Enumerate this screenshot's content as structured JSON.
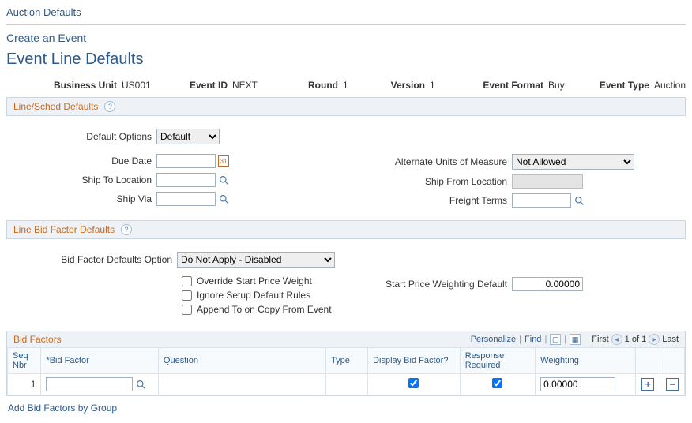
{
  "breadcrumb": "Auction Defaults",
  "create_link": "Create an Event",
  "page_title": "Event Line Defaults",
  "info": {
    "business_unit_label": "Business Unit",
    "business_unit": "US001",
    "event_id_label": "Event ID",
    "event_id": "NEXT",
    "round_label": "Round",
    "round": "1",
    "version_label": "Version",
    "version": "1",
    "event_format_label": "Event Format",
    "event_format": "Buy",
    "event_type_label": "Event Type",
    "event_type": "Auction"
  },
  "section1": {
    "title": "Line/Sched Defaults",
    "default_options_label": "Default Options",
    "default_options_value": "Default",
    "due_date_label": "Due Date",
    "due_date_value": "",
    "ship_to_label": "Ship To Location",
    "ship_to_value": "",
    "ship_via_label": "Ship Via",
    "ship_via_value": "",
    "alt_uom_label": "Alternate Units of Measure",
    "alt_uom_value": "Not Allowed",
    "ship_from_label": "Ship From Location",
    "freight_terms_label": "Freight Terms",
    "freight_terms_value": ""
  },
  "section2": {
    "title": "Line Bid Factor Defaults",
    "bid_factor_opt_label": "Bid Factor Defaults Option",
    "bid_factor_opt_value": "Do Not Apply - Disabled",
    "override_label": "Override Start Price Weight",
    "ignore_label": "Ignore Setup Default Rules",
    "append_label": "Append To on Copy From Event",
    "start_price_label": "Start Price Weighting Default",
    "start_price_value": "0.00000"
  },
  "grid": {
    "title": "Bid Factors",
    "personalize": "Personalize",
    "find": "Find",
    "first": "First",
    "counter": "1 of 1",
    "last": "Last",
    "headers": {
      "seq": "Seq Nbr",
      "bid_factor": "*Bid Factor",
      "question": "Question",
      "type": "Type",
      "display": "Display Bid Factor?",
      "response": "Response Required",
      "weighting": "Weighting"
    },
    "row": {
      "seq": "1",
      "bid_factor": "",
      "question": "",
      "type": "",
      "display_checked": true,
      "response_checked": true,
      "weighting": "0.00000"
    }
  },
  "footer_link": "Add Bid Factors by Group"
}
